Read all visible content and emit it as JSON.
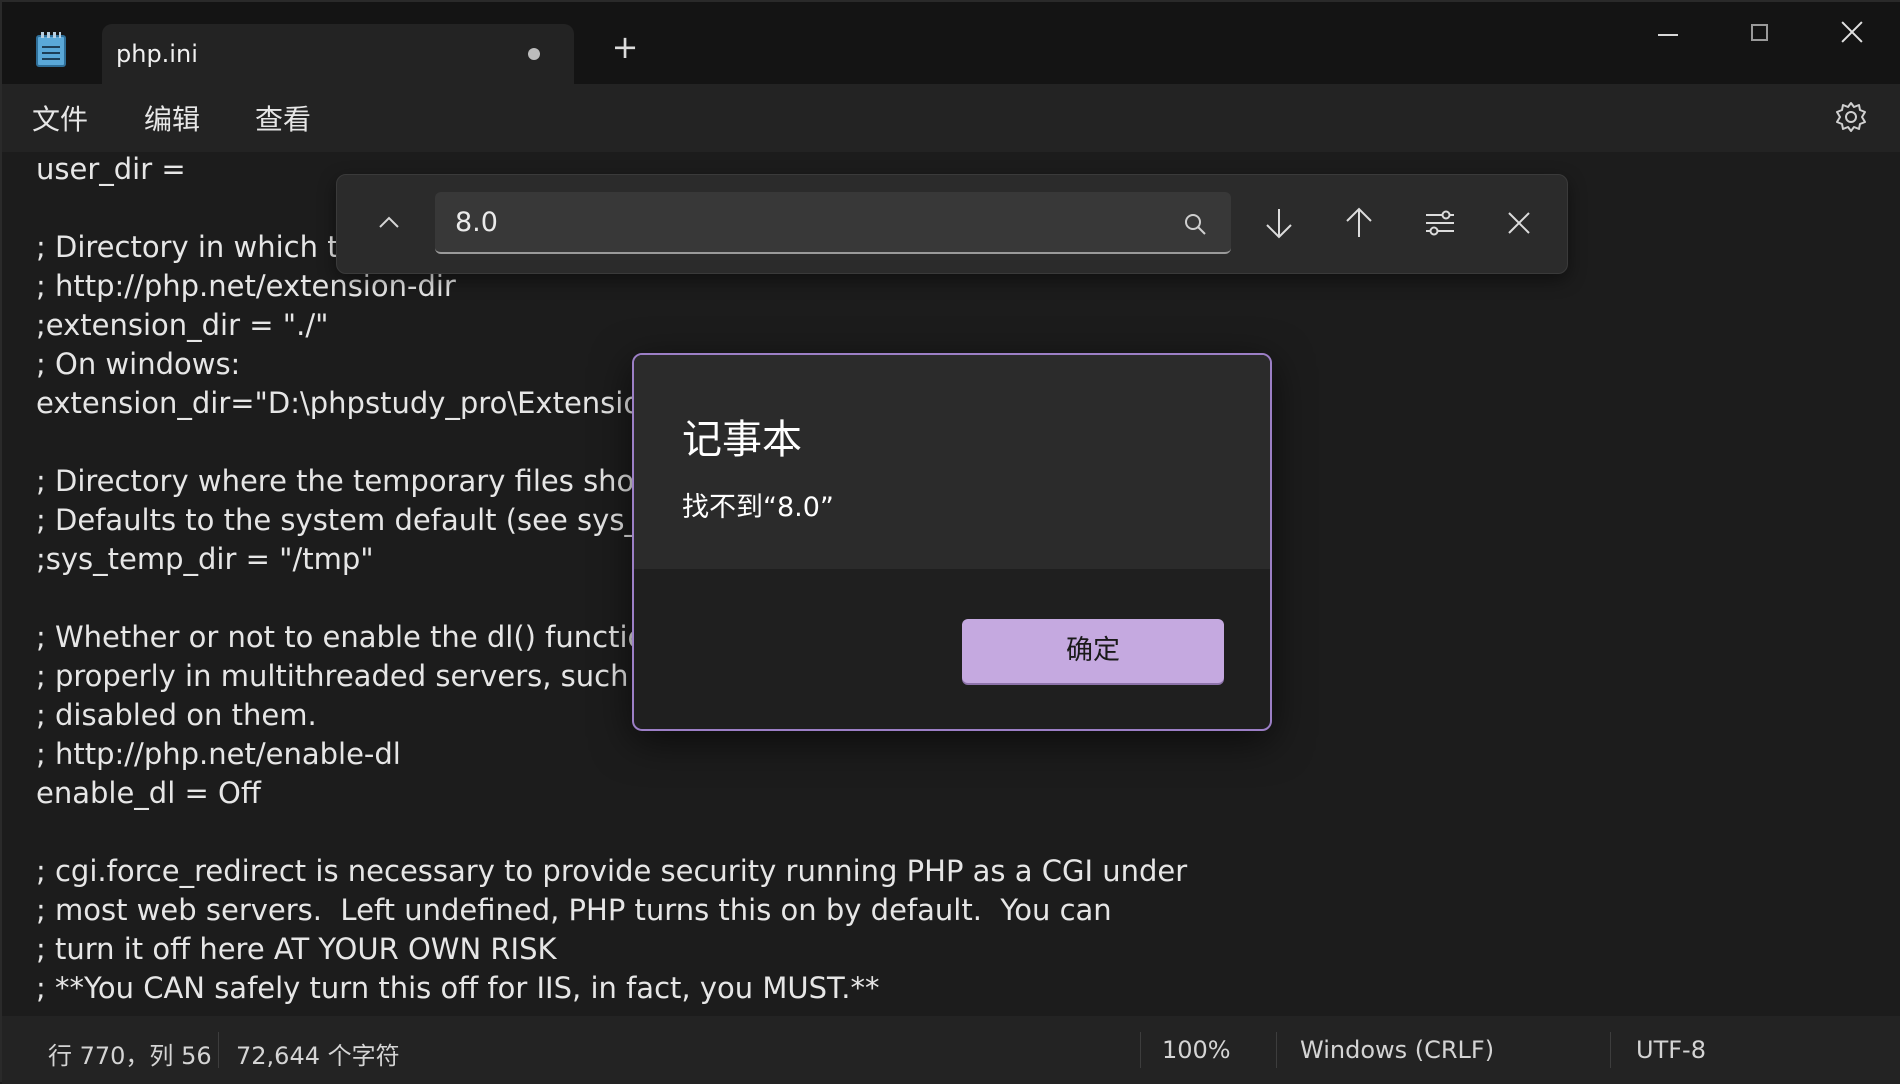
{
  "tab": {
    "title": "php.ini",
    "new_tab_label": "+"
  },
  "menu": {
    "file": "文件",
    "edit": "编辑",
    "view": "查看"
  },
  "editor": {
    "lines": [
      "user_dir =",
      "",
      "; Directory in which th",
      "; http://php.net/extension-dir",
      ";extension_dir = \"./\"",
      "; On windows:",
      "extension_dir=\"D:\\phpstudy_pro\\Extensions",
      "",
      "; Directory where the temporary files should",
      "; Defaults to the system default (see sys_get",
      ";sys_temp_dir = \"/tmp\"",
      "",
      "; Whether or not to enable the dl() function",
      "; properly in multithreaded servers, such as",
      "; disabled on them.",
      "; http://php.net/enable-dl",
      "enable_dl = Off",
      "",
      "; cgi.force_redirect is necessary to provide security running PHP as a CGI under",
      "; most web servers.  Left undefined, PHP turns this on by default.  You can",
      "; turn it off here AT YOUR OWN RISK",
      "; **You CAN safely turn this off for IIS, in fact, you MUST.**"
    ]
  },
  "find": {
    "value": "8.0"
  },
  "dialog": {
    "title": "记事本",
    "message": "找不到“8.0”",
    "ok_label": "确定"
  },
  "status": {
    "position": "行 770，列 56",
    "char_count": "72,644 个字符",
    "zoom": "100%",
    "line_ending": "Windows (CRLF)",
    "encoding": "UTF-8"
  }
}
